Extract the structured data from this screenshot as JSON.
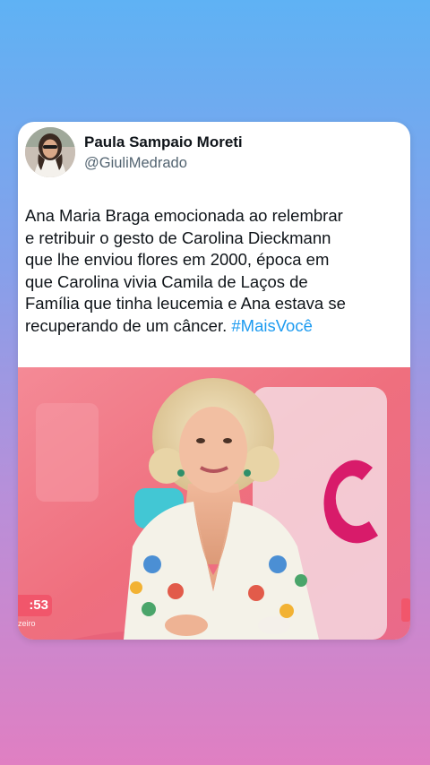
{
  "tweet": {
    "author_name": "Paula Sampaio Moreti",
    "author_handle": "@GiuliMedrado",
    "text_lines": [
      "Ana Maria Braga emocionada ao relembrar",
      "e retribuir o gesto de Carolina Dieckmann",
      "que lhe enviou flores em 2000, época em",
      "que Carolina vivia Camila de Laços de",
      "Família que tinha leucemia e Ana estava se"
    ],
    "text_last_line": "recuperando de um câncer. ",
    "hashtag": "#MaisVocê"
  },
  "media": {
    "clock_text": ":53",
    "clock_subtext": "zeiro"
  },
  "colors": {
    "hashtag": "#1d9bf0",
    "background_top": "#5fb2f4",
    "background_bottom": "#e07fc2",
    "studio_pink": "#f07a86",
    "clock_red": "#f1566b"
  }
}
